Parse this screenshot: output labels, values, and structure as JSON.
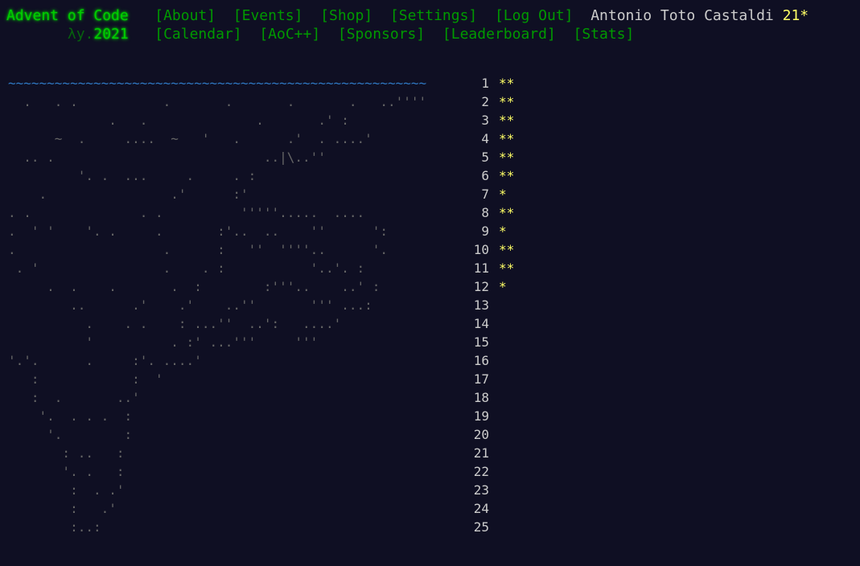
{
  "header": {
    "title": "Advent of Code",
    "year_prefix": "λy.",
    "year": "2021",
    "nav_top": [
      "[About]",
      "[Events]",
      "[Shop]",
      "[Settings]",
      "[Log Out]"
    ],
    "nav_bottom": [
      "[Calendar]",
      "[AoC++]",
      "[Sponsors]",
      "[Leaderboard]",
      "[Stats]"
    ],
    "user_name": "Antonio Toto Castaldi",
    "star_count": "21*"
  },
  "calendar": {
    "days": [
      {
        "day": "1",
        "stars": "**"
      },
      {
        "day": "2",
        "stars": "**"
      },
      {
        "day": "3",
        "stars": "**"
      },
      {
        "day": "4",
        "stars": "**"
      },
      {
        "day": "5",
        "stars": "**"
      },
      {
        "day": "6",
        "stars": "**"
      },
      {
        "day": "7",
        "stars": "*"
      },
      {
        "day": "8",
        "stars": "**"
      },
      {
        "day": "9",
        "stars": "*"
      },
      {
        "day": "10",
        "stars": "**"
      },
      {
        "day": "11",
        "stars": "**"
      },
      {
        "day": "12",
        "stars": "*"
      },
      {
        "day": "13",
        "stars": ""
      },
      {
        "day": "14",
        "stars": ""
      },
      {
        "day": "15",
        "stars": ""
      },
      {
        "day": "16",
        "stars": ""
      },
      {
        "day": "17",
        "stars": ""
      },
      {
        "day": "18",
        "stars": ""
      },
      {
        "day": "19",
        "stars": ""
      },
      {
        "day": "20",
        "stars": ""
      },
      {
        "day": "21",
        "stars": ""
      },
      {
        "day": "22",
        "stars": ""
      },
      {
        "day": "23",
        "stars": ""
      },
      {
        "day": "24",
        "stars": ""
      },
      {
        "day": "25",
        "stars": ""
      }
    ],
    "art_rows": [
      "~~~~~~~~~~~~~~~~~~~~~~~~~~~~~~~~~~~~~~~~~~~~~~~~~~~~~~",
      "  .   . .           .       .       .       .   ..''''",
      "             .   .              .       .' :          ",
      "      ~  .     ....  ~   '   .      .'  . ....'       ",
      "  .. .                           ..|\\..''             ",
      "         '. .  ...     .     . :                      ",
      "    .                .'      :'                       ",
      ". .              . .          '''''.....  ....        ",
      ".  ' '    '. .     .       :'..  ..    ''      ':     ",
      ".                   .      :   ''  ''''..      '.     ",
      " . '                .    . :           '..'. :        ",
      "     .  .    .       .  :        :'''..    ..' :      ",
      "        ..      .'    .'    ..''       ''' ...:       ",
      "          .    . .    : ...''  ..':   ....'           ",
      "          '          . :' ...'''     '''              ",
      "'.'.      .     :'. ....'                             ",
      "   :            :  '                                  ",
      "   :  .       ..'                                     ",
      "    '.  . . .  :                                      ",
      "     '.        :                                      ",
      "       : ..   :                                       ",
      "       '. .   :                                       ",
      "        :  . .'                                       ",
      "        :   .'                                        ",
      "        :..:                                          "
    ]
  },
  "colors": {
    "background": "#0f0f23",
    "title_green": "#00cc00",
    "link_green": "#009900",
    "star_gold": "#ffff66",
    "text_gray": "#cccccc"
  }
}
